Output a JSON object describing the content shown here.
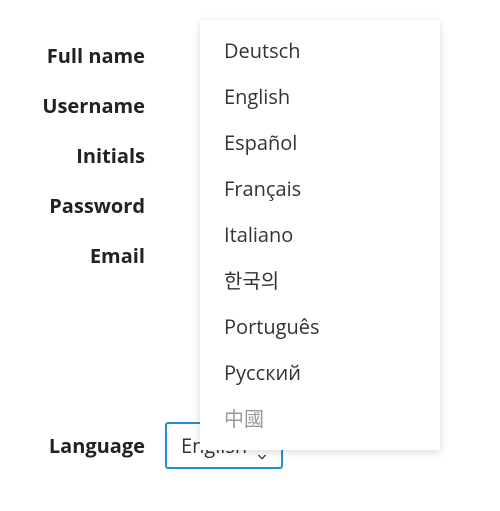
{
  "labels": {
    "full_name": "Full name",
    "username": "Username",
    "initials": "Initials",
    "password": "Password",
    "email": "Email",
    "language": "Language"
  },
  "language": {
    "selected": "English",
    "options": [
      "Deutsch",
      "English",
      "Español",
      "Français",
      "Italiano",
      "한국의",
      "Português",
      "Русский",
      "中國"
    ]
  },
  "colors": {
    "focus_border": "#2090d0",
    "muted_text": "#999999"
  }
}
